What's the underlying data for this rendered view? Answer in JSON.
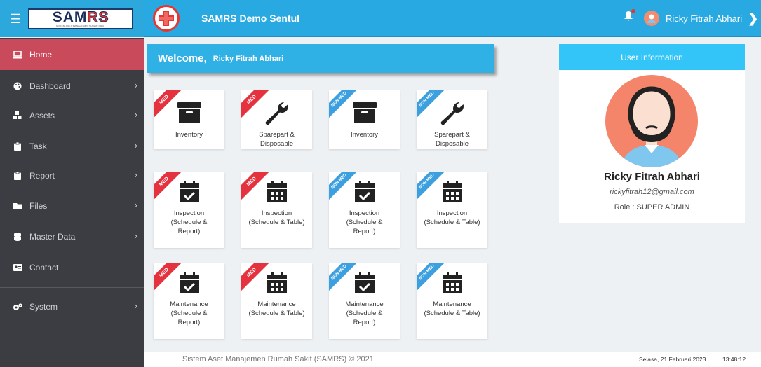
{
  "brand": {
    "logo_main": "SAM",
    "logo_accent": "RS",
    "logo_sub": "SISTEM ASET MANAJEMEN RUMAH SAKIT"
  },
  "header": {
    "hospital_name": "SAMRS Demo Sentul",
    "user_name": "Ricky Fitrah Abhari"
  },
  "sidebar": {
    "items": [
      {
        "label": "Home",
        "icon": "laptop-icon",
        "active": true
      },
      {
        "label": "Dashboard",
        "icon": "palette-icon"
      },
      {
        "label": "Assets",
        "icon": "cubes-icon"
      },
      {
        "label": "Task",
        "icon": "clipboard-icon"
      },
      {
        "label": "Report",
        "icon": "clipboard-icon"
      },
      {
        "label": "Files",
        "icon": "folder-icon"
      },
      {
        "label": "Master Data",
        "icon": "database-icon"
      },
      {
        "label": "Contact",
        "icon": "address-card-icon"
      },
      {
        "label": "System",
        "icon": "cogs-icon"
      }
    ]
  },
  "welcome": {
    "greeting": "Welcome,",
    "name": "Ricky Fitrah Abhari"
  },
  "tiles": [
    {
      "ribbon": "MED",
      "label_lines": [
        "Inventory"
      ],
      "icon": "archive-icon"
    },
    {
      "ribbon": "MED",
      "label_lines": [
        "Sparepart &",
        "Disposable"
      ],
      "icon": "wrench-icon"
    },
    {
      "ribbon": "NON MED",
      "label_lines": [
        "Inventory"
      ],
      "icon": "archive-icon"
    },
    {
      "ribbon": "NON MED",
      "label_lines": [
        "Sparepart &",
        "Disposable"
      ],
      "icon": "wrench-icon"
    },
    {
      "ribbon": "MED",
      "label_lines": [
        "Inspection",
        "(Schedule &",
        "Report)"
      ],
      "icon": "calendar-check-icon"
    },
    {
      "ribbon": "MED",
      "label_lines": [
        "Inspection",
        "(Schedule & Table)"
      ],
      "icon": "calendar-grid-icon"
    },
    {
      "ribbon": "NON MED",
      "label_lines": [
        "Inspection",
        "(Schedule &",
        "Report)"
      ],
      "icon": "calendar-check-icon"
    },
    {
      "ribbon": "NON MED",
      "label_lines": [
        "Inspection",
        "(Schedule & Table)"
      ],
      "icon": "calendar-grid-icon"
    },
    {
      "ribbon": "MED",
      "label_lines": [
        "Maintenance",
        "(Schedule &",
        "Report)"
      ],
      "icon": "calendar-check-icon"
    },
    {
      "ribbon": "MED",
      "label_lines": [
        "Maintenance",
        "(Schedule & Table)"
      ],
      "icon": "calendar-grid-icon"
    },
    {
      "ribbon": "NON MED",
      "label_lines": [
        "Maintenance",
        "(Schedule &",
        "Report)"
      ],
      "icon": "calendar-check-icon"
    },
    {
      "ribbon": "NON MED",
      "label_lines": [
        "Maintenance",
        "(Schedule & Table)"
      ],
      "icon": "calendar-grid-icon"
    }
  ],
  "user_info": {
    "title": "User Information",
    "name": "Ricky Fitrah Abhari",
    "email": "rickyfitrah12@gmail.com",
    "role": "Role : SUPER ADMIN"
  },
  "footer": {
    "copyright": "Sistem Aset Manajemen Rumah Sakit (SAMRS) © 2021",
    "date": "Selasa, 21 Februari 2023",
    "time": "13:48:12"
  },
  "colors": {
    "topbar": "#29a9e1",
    "sidebar": "#3b3d42",
    "active": "#c94a5b",
    "med": "#e5323f",
    "non_med": "#3b9fe0"
  }
}
